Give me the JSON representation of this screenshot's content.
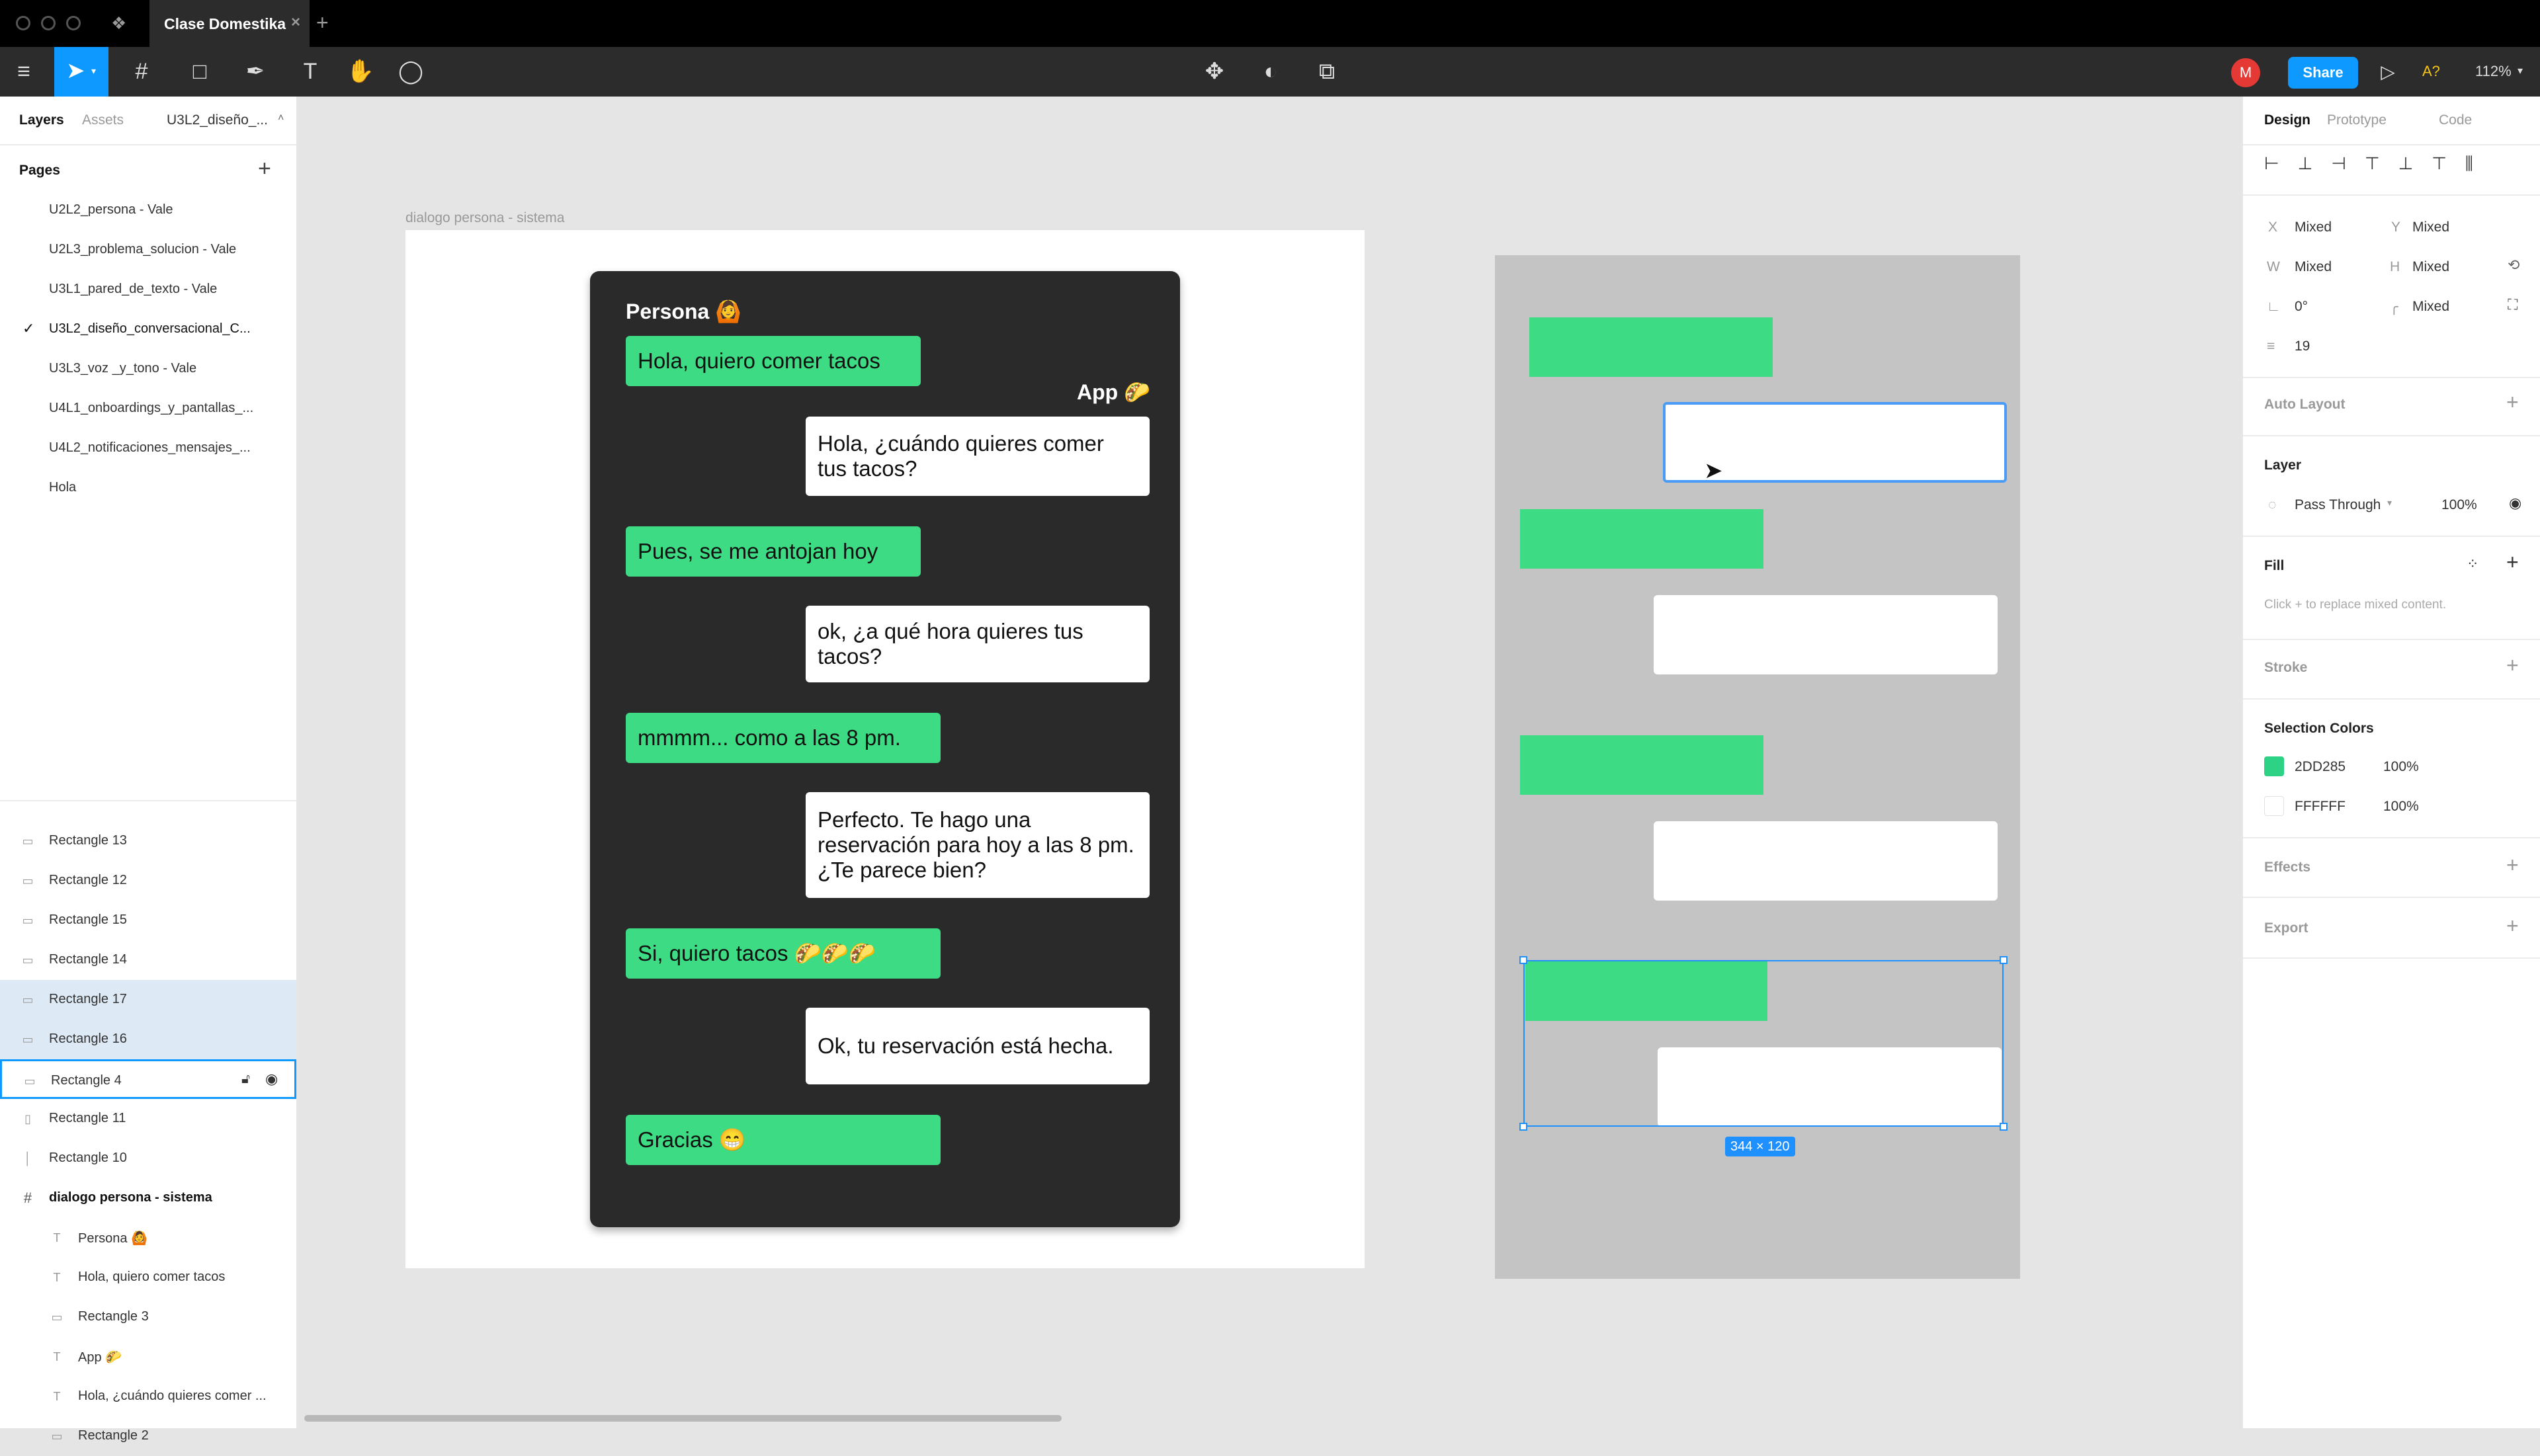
{
  "titlebar": {
    "tab_title": "Clase Domestika"
  },
  "toolbar": {
    "zoom": "112%",
    "share_label": "Share",
    "avatar_initial": "M",
    "alt_label": "A?"
  },
  "left_panel": {
    "tabs": [
      "Layers",
      "Assets"
    ],
    "file_dropdown": "U3L2_diseño_...",
    "pages_title": "Pages",
    "pages": [
      "U2L2_persona - Vale",
      "U2L3_problema_solucion - Vale",
      "U3L1_pared_de_texto - Vale",
      "U3L2_diseño_conversacional_C...",
      "U3L3_voz _y_tono - Vale",
      "U4L1_onboardings_y_pantallas_...",
      "U4L2_notificaciones_mensajes_...",
      "Hola"
    ],
    "layers": [
      "Rectangle 13",
      "Rectangle 12",
      "Rectangle 15",
      "Rectangle 14",
      "Rectangle 17",
      "Rectangle 16",
      "Rectangle 4",
      "Rectangle 11",
      "Rectangle 10",
      "dialogo persona - sistema",
      "Persona 🙆",
      "Hola, quiero comer tacos",
      "Rectangle 3",
      "App 🌮",
      "Hola, ¿cuándo quieres comer ...",
      "Rectangle 2"
    ]
  },
  "right_panel": {
    "tabs": [
      "Design",
      "Prototype",
      "Code"
    ],
    "x_label": "X",
    "x_value": "Mixed",
    "y_label": "Y",
    "y_value": "Mixed",
    "w_label": "W",
    "w_value": "Mixed",
    "h_label": "H",
    "h_value": "Mixed",
    "rotation": "0°",
    "radius": "Mixed",
    "spacing": "19",
    "auto_layout": "Auto Layout",
    "layer_title": "Layer",
    "blend_mode": "Pass Through",
    "layer_opacity": "100%",
    "fill_title": "Fill",
    "fill_hint": "Click + to replace mixed content.",
    "stroke_title": "Stroke",
    "selection_colors_title": "Selection Colors",
    "selection_colors": [
      {
        "hex": "2DD285",
        "opacity": "100%",
        "swatch": "#2DD285"
      },
      {
        "hex": "FFFFFF",
        "opacity": "100%",
        "swatch": "#FFFFFF"
      }
    ],
    "effects_title": "Effects",
    "export_title": "Export"
  },
  "canvas": {
    "frame_label": "dialogo persona - sistema",
    "chat": {
      "persona_label": "Persona 🙆",
      "app_label": "App 🌮",
      "messages": [
        "Hola, quiero comer tacos",
        "Hola, ¿cuándo quieres comer tus tacos?",
        "Pues, se me antojan hoy",
        "ok, ¿a qué hora quieres tus tacos?",
        "mmmm... como a las 8 pm.",
        "Perfecto. Te hago una reservación para hoy a las 8 pm. ¿Te parece bien?",
        "Si, quiero tacos 🌮🌮🌮",
        "Ok, tu reservación está hecha.",
        "Gracias 😁"
      ]
    },
    "selection_size": "344 × 120"
  },
  "colors": {
    "accent": "#0d99ff",
    "bubble_green": "#3DDC84",
    "chat_bg": "#2a2a2a",
    "wireframe_bg": "#c4c4c4"
  }
}
